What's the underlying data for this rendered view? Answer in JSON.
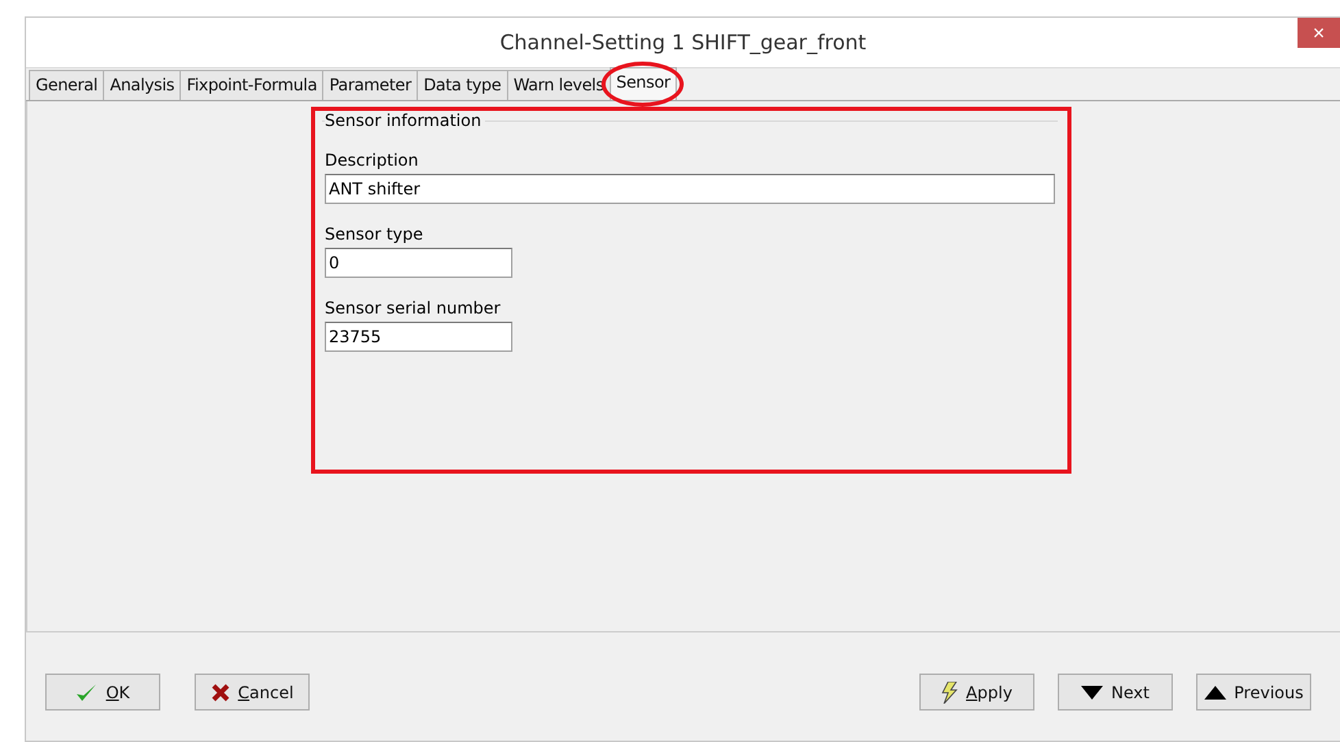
{
  "window": {
    "title": "Channel-Setting 1 SHIFT_gear_front",
    "close": "×"
  },
  "tabs": [
    {
      "label": "General",
      "selected": false,
      "highlighted": false
    },
    {
      "label": "Analysis",
      "selected": false,
      "highlighted": false
    },
    {
      "label": "Fixpoint-Formula",
      "selected": false,
      "highlighted": false
    },
    {
      "label": "Parameter",
      "selected": false,
      "highlighted": false
    },
    {
      "label": "Data type",
      "selected": false,
      "highlighted": false
    },
    {
      "label": "Warn levels",
      "selected": false,
      "highlighted": false
    },
    {
      "label": "Sensor",
      "selected": true,
      "highlighted": true
    }
  ],
  "group": {
    "title": "Sensor information",
    "highlighted": true,
    "fields": [
      {
        "label": "Description",
        "value": "ANT shifter",
        "kind": "wide"
      },
      {
        "label": "Sensor type",
        "value": "0",
        "kind": "short"
      },
      {
        "label": "Sensor serial number",
        "value": "23755",
        "kind": "short"
      }
    ]
  },
  "buttons_left": [
    {
      "label": "OK",
      "kind": "ok",
      "mnemonic": true
    },
    {
      "label": "Cancel",
      "kind": "cancel",
      "mnemonic": true
    }
  ],
  "buttons_right": [
    {
      "label": "Apply",
      "kind": "apply",
      "mnemonic": true
    },
    {
      "label": "Next",
      "kind": "next",
      "mnemonic": false
    },
    {
      "label": "Previous",
      "kind": "previous",
      "mnemonic": false
    }
  ]
}
